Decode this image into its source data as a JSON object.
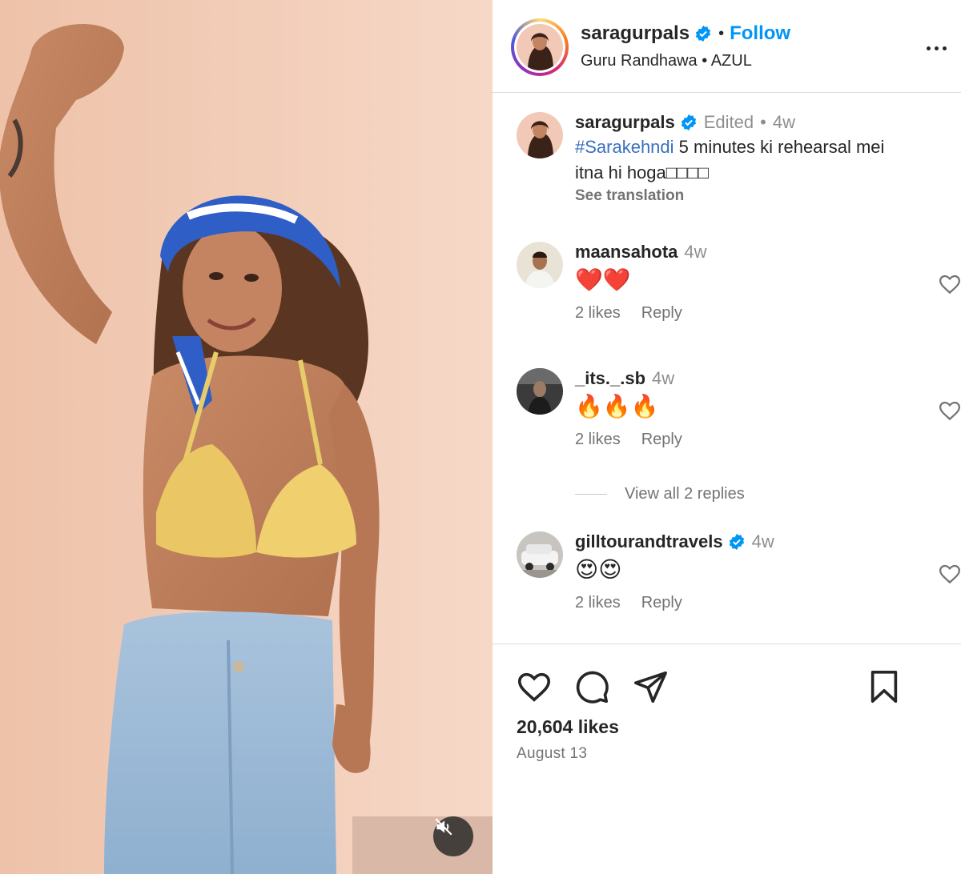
{
  "post": {
    "username": "saragurpals",
    "follow_label": "Follow",
    "audio_artist": "Guru Randhawa",
    "audio_title": "AZUL",
    "audio_sep": "•",
    "dot": "•"
  },
  "caption": {
    "username": "saragurpals",
    "edited": "Edited",
    "dot": "•",
    "age": "4w",
    "hashtag": "#Sarakehndi",
    "text_line1": " 5 minutes ki rehearsal mei",
    "text_line2": "itna hi hoga□□□□",
    "see_translation": "See translation"
  },
  "comments": [
    {
      "username": "maansahota",
      "age": "4w",
      "text": "❤️❤️",
      "likes": "2 likes",
      "reply": "Reply",
      "verified": false
    },
    {
      "username": "_its._.sb",
      "age": "4w",
      "text": "🔥🔥🔥",
      "likes": "2 likes",
      "reply": "Reply",
      "verified": false
    },
    {
      "username": "gilltourandtravels",
      "age": "4w",
      "text": "😍😍",
      "likes": "2 likes",
      "reply": "Reply",
      "verified": true
    }
  ],
  "view_replies": "View all 2 replies",
  "footer": {
    "likes": "20,604 likes",
    "date": "August 13"
  },
  "colors": {
    "accent": "#0095f6",
    "text": "#262626",
    "muted": "#737373",
    "divider": "#dbdbdb"
  },
  "icons": [
    "verified-badge-icon",
    "more-options-icon",
    "heart-icon",
    "comment-icon",
    "share-icon",
    "bookmark-icon",
    "mute-icon"
  ]
}
